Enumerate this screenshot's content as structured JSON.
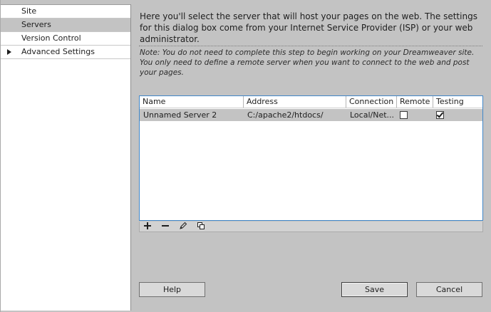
{
  "sidebar": {
    "items": [
      {
        "label": "Site"
      },
      {
        "label": "Servers"
      },
      {
        "label": "Version Control"
      },
      {
        "label": "Advanced Settings"
      }
    ]
  },
  "main": {
    "intro": "Here you'll select the server that will host your pages on the web. The settings for this dialog box come from your Internet Service Provider (ISP) or your web administrator.",
    "note": "Note: You do not need to complete this step to begin working on your Dreamweaver site. You only need to define a remote server when you want to connect to the web and post your pages."
  },
  "table": {
    "headers": [
      "Name",
      "Address",
      "Connection",
      "Remote",
      "Testing"
    ],
    "rows": [
      {
        "name": "Unnamed Server 2",
        "address": "C:/apache2/htdocs/",
        "connection": "Local/Net...",
        "remote": false,
        "testing": true
      }
    ]
  },
  "toolbar": {
    "icons": [
      "plus-icon",
      "minus-icon",
      "pencil-icon",
      "duplicate-icon"
    ]
  },
  "buttons": {
    "help": "Help",
    "save": "Save",
    "cancel": "Cancel"
  }
}
